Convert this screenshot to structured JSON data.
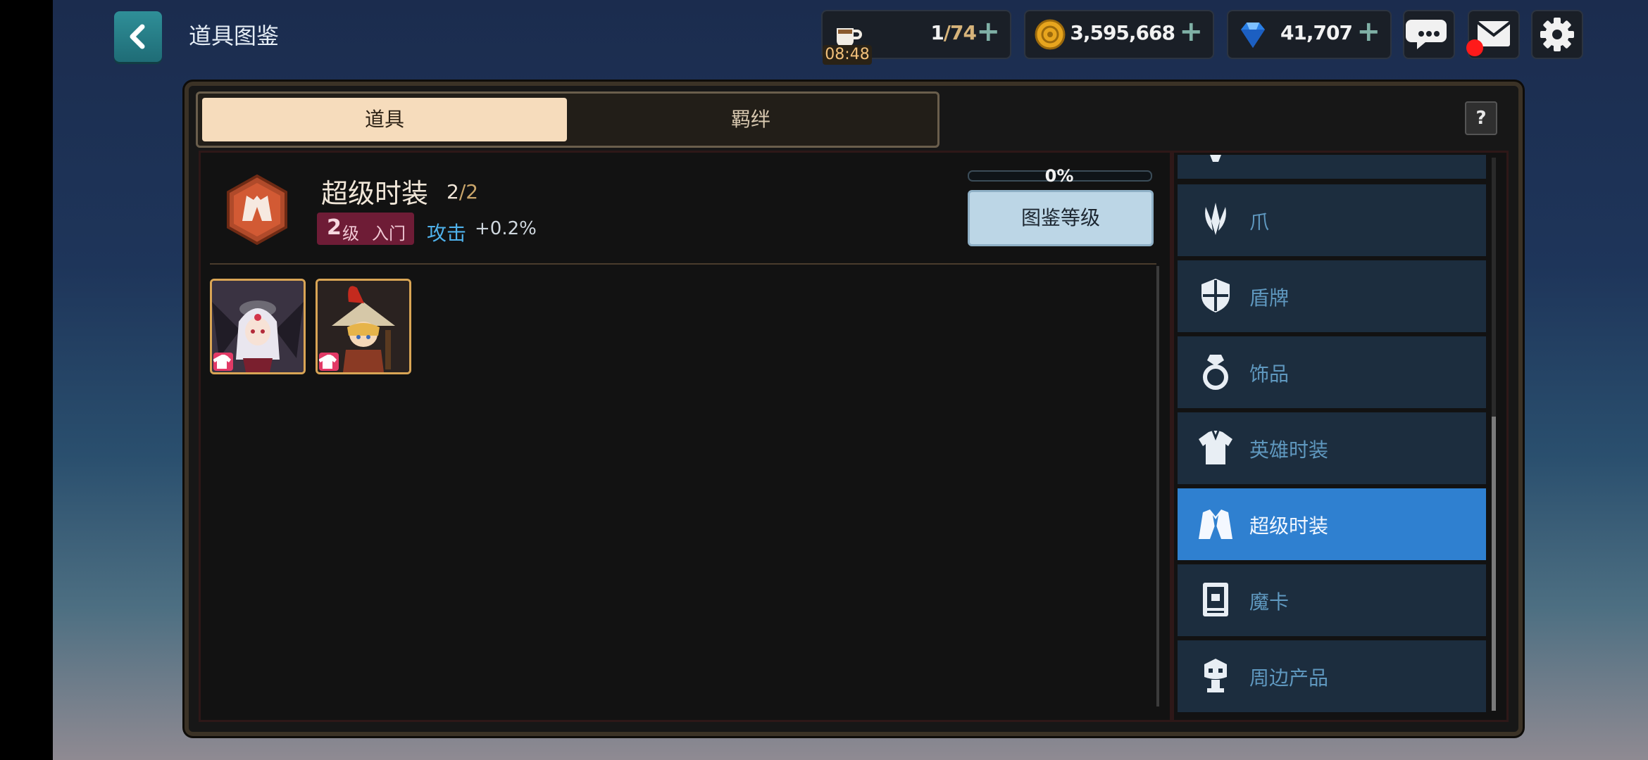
{
  "header": {
    "title": "道具图鉴"
  },
  "resources": {
    "stamina": {
      "value": "1",
      "max": "/74",
      "timer": "08:48"
    },
    "gold": {
      "value": "3,595,668"
    },
    "gems": {
      "value": "41,707"
    }
  },
  "tabs": [
    {
      "label": "道具",
      "active": true
    },
    {
      "label": "羁绊",
      "active": false
    }
  ],
  "help": {
    "label": "?"
  },
  "category": {
    "title": "超级时装",
    "count_current": "2",
    "count_sep": "/",
    "count_total": "2",
    "level_num": "2",
    "level_unit": "级",
    "level_name": "入门",
    "stat_name": "攻击",
    "stat_value": "+0.2%",
    "progress_label": "0%",
    "progress": 0,
    "codex_button": "图鉴等级"
  },
  "items": [
    {
      "name": "white-haired-hero-costume",
      "icon": "shirt-icon"
    },
    {
      "name": "red-hat-hero-costume",
      "icon": "shirt-icon"
    }
  ],
  "sidebar": {
    "items": [
      {
        "label": "",
        "icon": "partial-icon"
      },
      {
        "label": "爪",
        "icon": "claw-icon"
      },
      {
        "label": "盾牌",
        "icon": "shield-icon"
      },
      {
        "label": "饰品",
        "icon": "ring-icon"
      },
      {
        "label": "英雄时装",
        "icon": "shirt-icon"
      },
      {
        "label": "超级时装",
        "icon": "suit-icon",
        "selected": true
      },
      {
        "label": "魔卡",
        "icon": "card-icon"
      },
      {
        "label": "周边产品",
        "icon": "figure-icon"
      }
    ]
  },
  "colors": {
    "accent": "#2f80d0",
    "level_badge": "#6e1c36",
    "stat": "#4fb1ea",
    "tab_active": "#f6dcbc"
  }
}
